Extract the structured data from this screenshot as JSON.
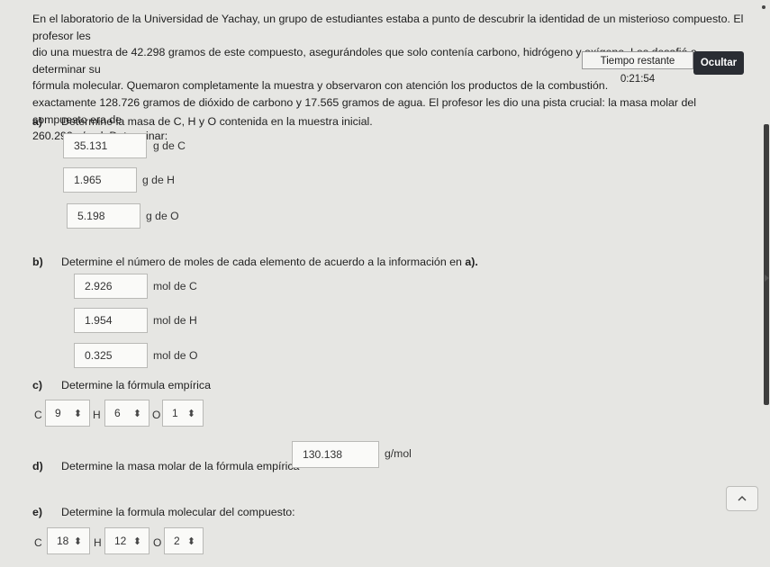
{
  "problem": {
    "line1": "En el laboratorio de la Universidad de Yachay, un grupo de estudiantes estaba a punto de descubrir la identidad de un misterioso compuesto. El profesor les",
    "line2": "dio una muestra de 42.298 gramos de este compuesto, asegurándoles que solo contenía carbono, hidrógeno y oxígeno. Los desafió a determinar su",
    "line3": "fórmula molecular. Quemaron completamente la muestra y observaron con atención los productos de la combustión.",
    "line4": "exactamente 128.726 gramos de dióxido de carbono y 17.565 gramos de agua. El profesor les dio una pista crucial: la masa molar del compuesto era de",
    "line5": "260.292 g/mol. Determinar:"
  },
  "timer": {
    "label": "Tiempo restante 0:21:54"
  },
  "hide_button": {
    "label": "Ocultar"
  },
  "part_a": {
    "letter": "a)",
    "text": "Determine la masa de C, H y O contenida en la muestra inicial.",
    "fields": [
      {
        "value": "35.131",
        "unit": "g de C"
      },
      {
        "value": "1.965",
        "unit": "g de H"
      },
      {
        "value": "5.198",
        "unit": "g de O"
      }
    ]
  },
  "part_b": {
    "letter": "b)",
    "text": "Determine el número de moles de cada elemento de acuerdo a la información en",
    "text_ref": "a).",
    "fields": [
      {
        "value": "2.926",
        "unit": "mol de C"
      },
      {
        "value": "1.954",
        "unit": "mol de H"
      },
      {
        "value": "0.325",
        "unit": "mol de O"
      }
    ]
  },
  "part_c": {
    "letter": "c)",
    "text": "Determine la fórmula empírica",
    "selects": [
      {
        "element": "C",
        "value": "9"
      },
      {
        "element": "H",
        "value": "6"
      },
      {
        "element": "O",
        "value": "1"
      }
    ]
  },
  "part_d": {
    "letter": "d)",
    "text": "Determine la masa molar de la fórmula empírica=",
    "value": "130.138",
    "unit": "g/mol"
  },
  "part_e": {
    "letter": "e)",
    "text": "Determine la formula molecular del compuesto:",
    "selects": [
      {
        "element": "C",
        "value": "18"
      },
      {
        "element": "H",
        "value": "12"
      },
      {
        "element": "O",
        "value": "2"
      }
    ]
  }
}
